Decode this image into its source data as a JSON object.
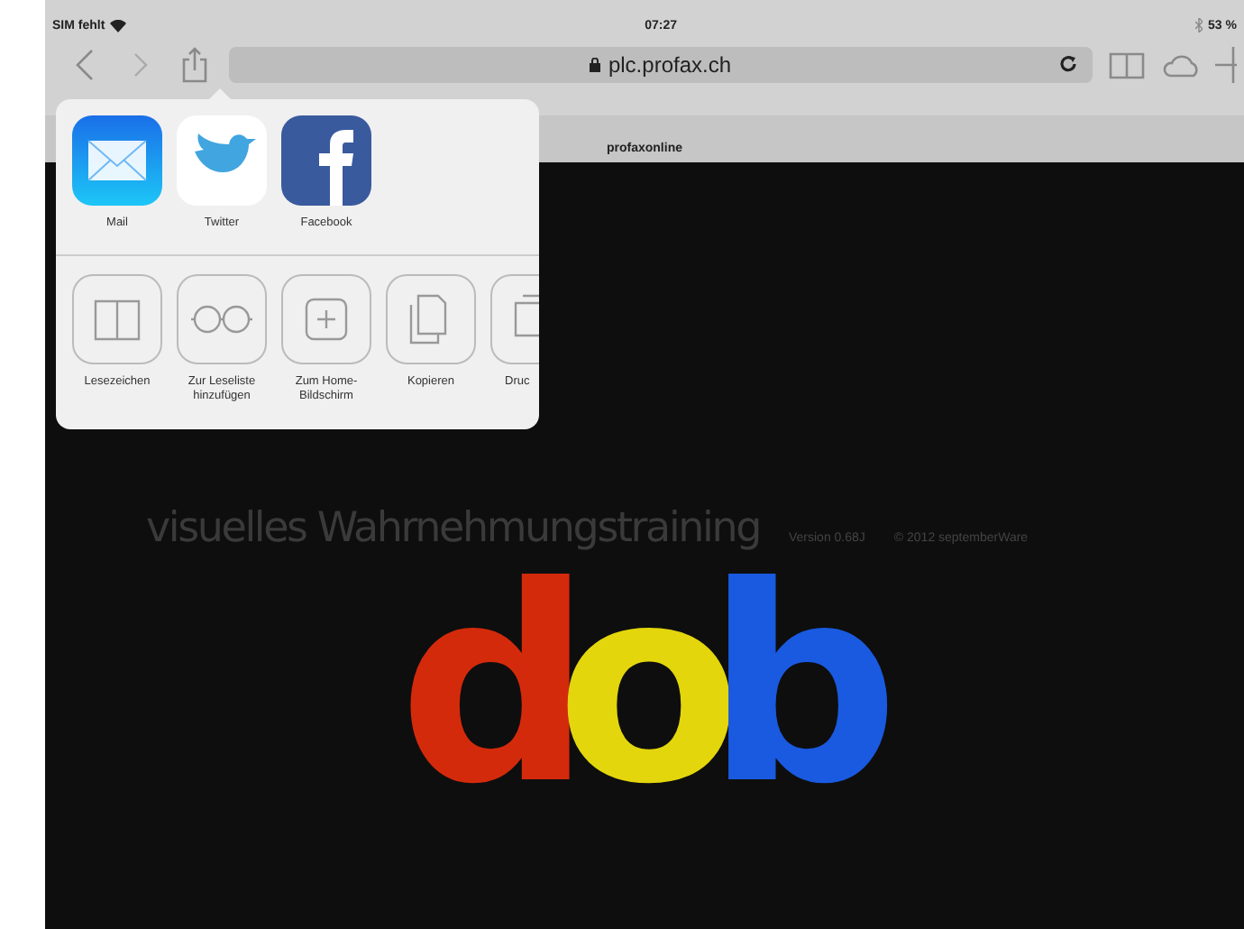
{
  "status_bar": {
    "carrier": "SIM fehlt",
    "time": "07:27",
    "battery": "53 %"
  },
  "toolbar": {
    "url": "plc.profax.ch"
  },
  "tab": {
    "title": "profaxonline"
  },
  "share_sheet": {
    "apps": [
      {
        "kind": "mail",
        "label": "Mail"
      },
      {
        "kind": "twitter",
        "label": "Twitter"
      },
      {
        "kind": "facebook",
        "label": "Facebook"
      }
    ],
    "actions": [
      {
        "kind": "bookmark",
        "label": "Lesezeichen"
      },
      {
        "kind": "glasses",
        "label": "Zur Leseliste hinzufügen"
      },
      {
        "kind": "plus",
        "label": "Zum Home-Bildschirm"
      },
      {
        "kind": "copy",
        "label": "Kopieren"
      },
      {
        "kind": "print",
        "label": "Druc"
      }
    ]
  },
  "page": {
    "title": "visuelles Wahrnehmungstraining",
    "version": "Version 0.68J",
    "copyright": "© 2012 septemberWare",
    "logo": [
      {
        "letter": "d",
        "color": "#d42a0c"
      },
      {
        "letter": "o",
        "color": "#e3d60c"
      },
      {
        "letter": "b",
        "color": "#1a5ae0"
      }
    ]
  }
}
